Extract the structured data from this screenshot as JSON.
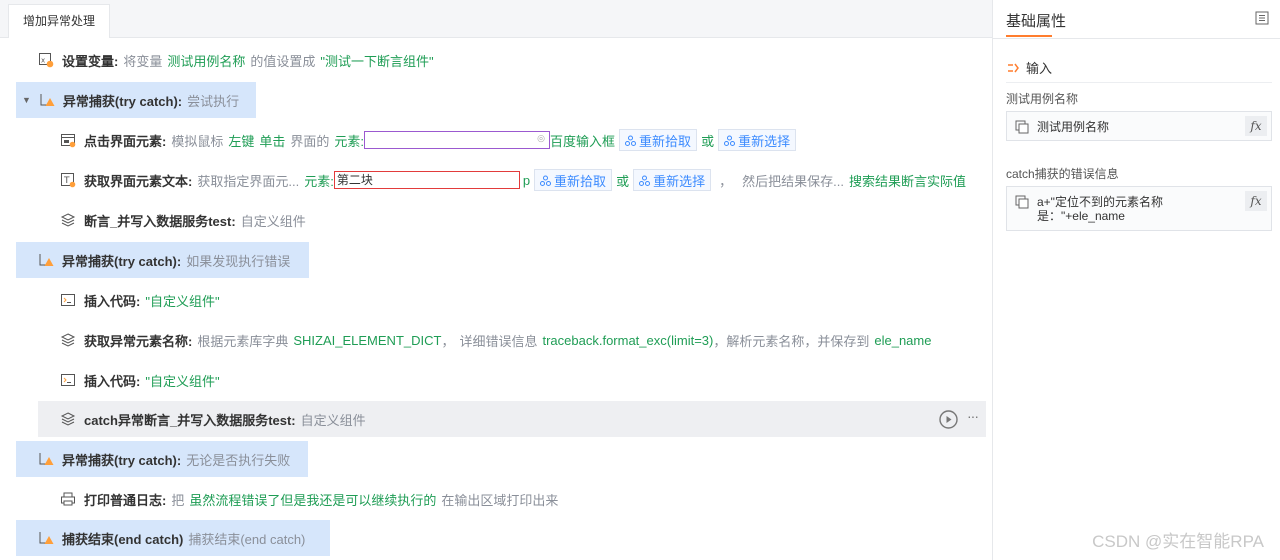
{
  "tab": {
    "label": "增加异常处理"
  },
  "rows": [
    {
      "title": "设置变量:",
      "parts": [
        "将变量",
        "测试用例名称",
        "的值设置成",
        "\"测试一下断言组件\""
      ]
    },
    {
      "title": "异常捕获(try catch):",
      "desc": "尝试执行"
    },
    {
      "title": "点击界面元素:",
      "parts": [
        "模拟鼠标",
        "左键",
        "单击",
        "界面的",
        "元素:",
        "百度输入框",
        "重新拾取",
        "或",
        "重新选择"
      ]
    },
    {
      "title": "获取界面元素文本:",
      "parts": [
        "获取指定界面元...",
        "元素:",
        "第二块",
        "p",
        "重新拾取",
        "或",
        "重新选择",
        "，",
        "然后把结果保存...",
        "搜索结果断言实际值"
      ]
    },
    {
      "title": "断言_并写入数据服务test:",
      "desc": "自定义组件"
    },
    {
      "title": "异常捕获(try catch):",
      "desc": "如果发现执行错误"
    },
    {
      "title": "插入代码:",
      "parts": [
        "\"自定义组件\""
      ]
    },
    {
      "title": "获取异常元素名称:",
      "parts": [
        "根据元素库字典",
        "SHIZAI_ELEMENT_DICT",
        "，",
        "详细错误信息",
        "traceback.format_exc(limit=3)",
        "，解析元素名称，并保存到",
        "ele_name"
      ]
    },
    {
      "title": "插入代码:",
      "parts": [
        "\"自定义组件\""
      ]
    },
    {
      "title": "catch异常断言_并写入数据服务test:",
      "desc": "自定义组件"
    },
    {
      "title": "异常捕获(try catch):",
      "desc": "无论是否执行失败"
    },
    {
      "title": "打印普通日志:",
      "parts": [
        "把",
        "虽然流程错误了但是我还是可以继续执行的",
        "在输出区域打印出来"
      ]
    },
    {
      "title": "捕获结束(end catch)",
      "desc": "捕获结束(end catch)"
    }
  ],
  "panel": {
    "title": "基础属性",
    "section": "输入",
    "fields": [
      {
        "label": "测试用例名称",
        "value": "测试用例名称",
        "fx": "fx"
      },
      {
        "label": "catch捕获的错误信息",
        "value_line1": "a+\"定位不到的元素名称",
        "value_line2": "是：\"+ele_name",
        "fx": "fx"
      }
    ]
  },
  "watermark": "CSDN @实在智能RPA",
  "colors": {
    "accent": "#ff7d2e",
    "catch_bg": "#d6e6fb",
    "green": "#1f9d55",
    "blue": "#3c8bff"
  },
  "icons": [
    "variable-icon",
    "warning-icon",
    "click-icon",
    "text-icon",
    "layers-icon",
    "code-icon",
    "print-icon",
    "play-icon",
    "more-icon",
    "collapse-icon",
    "input-icon",
    "variable-value-icon"
  ]
}
